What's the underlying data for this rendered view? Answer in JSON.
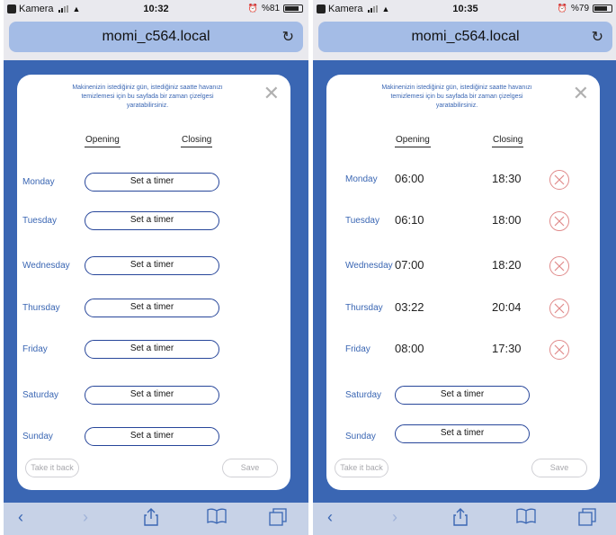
{
  "phones": [
    {
      "status": {
        "carrier": "Kamera",
        "time": "10:32",
        "battery": "%81",
        "battery_level": 0.81
      },
      "url": "momi_c564.local",
      "intro": "Makinenizin istediğiniz gün, istediğiniz saatte havanızı temizlemesi için bu sayfada bir zaman çizelgesi yaratabilirsiniz.",
      "headers": {
        "opening": "Opening",
        "closing": "Closing"
      },
      "days": [
        {
          "name": "Monday",
          "button": "Set a timer"
        },
        {
          "name": "Tuesday",
          "button": "Set a timer"
        },
        {
          "name": "Wednesday",
          "button": "Set a timer"
        },
        {
          "name": "Thursday",
          "button": "Set a timer"
        },
        {
          "name": "Friday",
          "button": "Set a timer"
        },
        {
          "name": "Saturday",
          "button": "Set a timer"
        },
        {
          "name": "Sunday",
          "button": "Set a timer"
        }
      ],
      "actions": {
        "back": "Take it back",
        "save": "Save"
      }
    },
    {
      "status": {
        "carrier": "Kamera",
        "time": "10:35",
        "battery": "%79",
        "battery_level": 0.79
      },
      "url": "momi_c564.local",
      "intro": "Makinenizin istediğiniz gün, istediğiniz saatte havanızı temizlemesi için bu sayfada bir zaman çizelgesi yaratabilirsiniz.",
      "headers": {
        "opening": "Opening",
        "closing": "Closing"
      },
      "days": [
        {
          "name": "Monday",
          "open": "06:00",
          "close": "18:30"
        },
        {
          "name": "Tuesday",
          "open": "06:10",
          "close": "18:00"
        },
        {
          "name": "Wednesday",
          "open": "07:00",
          "close": "18:20"
        },
        {
          "name": "Thursday",
          "open": "03:22",
          "close": "20:04"
        },
        {
          "name": "Friday",
          "open": "08:00",
          "close": "17:30"
        },
        {
          "name": "Saturday",
          "button": "Set a timer"
        },
        {
          "name": "Sunday",
          "button": "Set a timer"
        }
      ],
      "actions": {
        "back": "Take it back",
        "save": "Save"
      }
    }
  ],
  "colors": {
    "brand_blue": "#3a66b3",
    "delete_red": "#e08a8a"
  },
  "icons": [
    "back-arrow-icon",
    "forward-arrow-icon",
    "share-icon",
    "bookmarks-icon",
    "tabs-icon",
    "reload-icon",
    "close-icon",
    "delete-icon"
  ]
}
